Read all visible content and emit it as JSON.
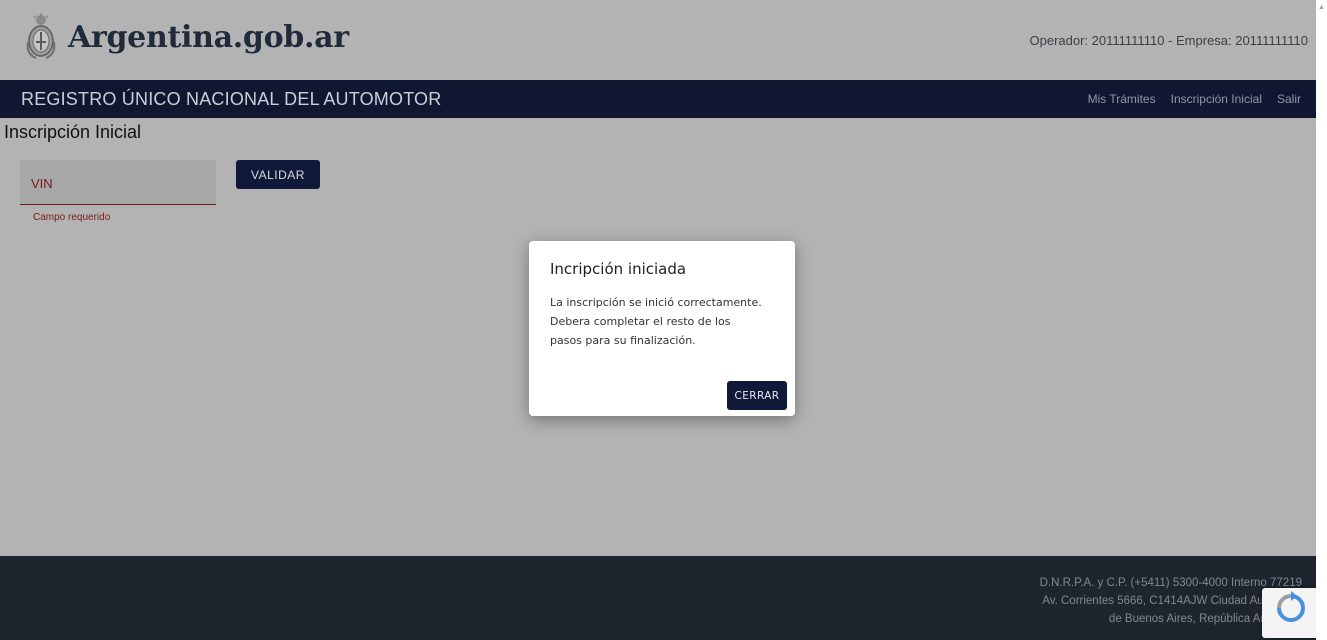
{
  "header": {
    "logo_text": "Argentina.gob.ar",
    "operator_text": "Operador: 20111111110 - Empresa: 20111111110"
  },
  "navbar": {
    "title": "REGISTRO ÚNICO NACIONAL DEL AUTOMOTOR",
    "links": [
      "Mis Trámites",
      "Inscripción Inicial",
      "Salir"
    ]
  },
  "main": {
    "page_title": "Inscripción Inicial",
    "vin_label": "VIN",
    "vin_error": "Campo requerido",
    "validar_label": "VALIDAR"
  },
  "modal": {
    "title": "Incripción iniciada",
    "body_lines": [
      "La inscripción se inició correctamente.",
      "Debera completar el resto de los",
      "pasos para su finalización."
    ],
    "close_label": "CERRAR"
  },
  "footer": {
    "lines": [
      "D.N.R.P.A. y C.P. (+5411) 5300-4000 Interno 77219",
      "Av. Corrientes 5666, C1414AJW Ciudad Autónoma",
      "de Buenos Aires, República Argentina"
    ]
  },
  "colors": {
    "navbar": "#101730",
    "button": "#10193a",
    "footer": "#1e252f",
    "error": "#7a1a1a",
    "overlay": "#b3b3b3"
  },
  "icons": {
    "logo": "argentina-coat-of-arms-icon",
    "recaptcha": "recaptcha-icon",
    "scroll": "scroll-up-arrow-icon"
  }
}
